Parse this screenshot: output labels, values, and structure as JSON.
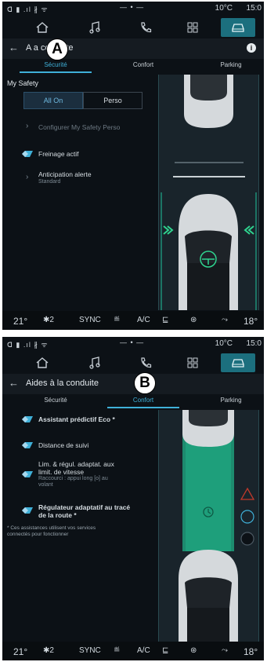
{
  "screens": [
    {
      "status": {
        "left": "ᗡ ▮ .ıl ∦ ᯤ",
        "mid": "— • —",
        "temp": "10°C",
        "time": "15:0"
      },
      "nav": {
        "home_icon": "home-icon",
        "music_icon": "music-icon",
        "phone_icon": "phone-icon",
        "apps_icon": "apps-icon",
        "car_icon": "car-icon"
      },
      "title_bar": {
        "back": "←",
        "title": "A     a conduite",
        "info": "i"
      },
      "tabs": [
        "Sécurité",
        "Confort",
        "Parking"
      ],
      "active_tab": 0,
      "badge": "A",
      "safety": {
        "section_title": "My Safety",
        "segments": [
          "All On",
          "Perso"
        ],
        "configure": "Configurer My Safety Perso",
        "braking": "Freinage actif",
        "anticipation": "Anticipation alerte",
        "anticipation_sub": "Standard"
      },
      "bottom": {
        "temp_left": "21°",
        "fan": "✱2",
        "sync": "SYNC",
        "ac": "A/C",
        "temp_right": "18°"
      }
    },
    {
      "status": {
        "left": "ᗡ ▮ .ıl ∦ ᯤ",
        "mid": "— • —",
        "temp": "10°C",
        "time": "15:0"
      },
      "title_bar": {
        "back": "←",
        "title": "Aides à la conduite"
      },
      "tabs": [
        "Sécurité",
        "Confort",
        "Parking"
      ],
      "active_tab": 1,
      "badge": "B",
      "comfort": {
        "eco": "Assistant prédictif Eco *",
        "distance": "Distance de suivi",
        "speed_line1": "Lim. & régul. adaptat. aux",
        "speed_line2": "limit. de vitesse",
        "speed_sub1": "Raccourci : appui long [o] au",
        "speed_sub2": "volant",
        "route_line1": "Régulateur adaptatif au tracé",
        "route_line2": "de la route *",
        "footnote1": "* Ces assistances utilisent vos services",
        "footnote2": "connectés pour fonctionner"
      },
      "bottom": {
        "temp_left": "21°",
        "fan": "✱2",
        "sync": "SYNC",
        "ac": "A/C",
        "temp_right": "18°"
      }
    }
  ],
  "colors": {
    "accent": "#3fb0d8",
    "active_nav": "#1c6f7e",
    "green_zone": "#1fae86",
    "chevron_green": "#2fd38f",
    "alert_red": "#c0392b"
  }
}
